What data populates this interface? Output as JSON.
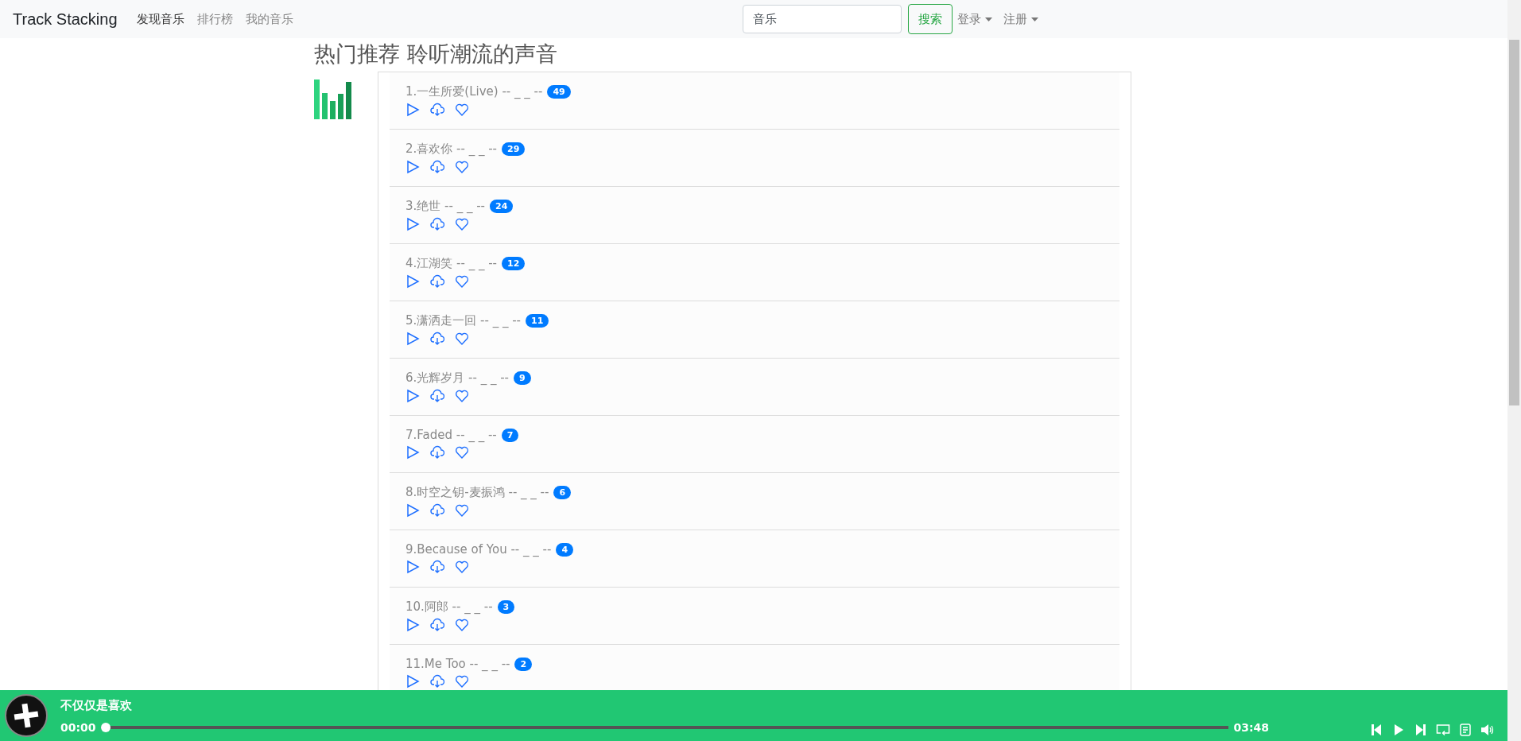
{
  "navbar": {
    "brand": "Track Stacking",
    "links": [
      {
        "label": "发现音乐",
        "selected": true
      },
      {
        "label": "排行榜",
        "selected": false
      },
      {
        "label": "我的音乐",
        "selected": false
      }
    ],
    "search": {
      "value": "音乐"
    },
    "search_button": "搜索",
    "menus": [
      "登录",
      "注册"
    ]
  },
  "heading": "热门推荐 聆听潮流的声音",
  "songs": [
    {
      "title": "1.一生所爱(Live) -- _ _ --",
      "count": "49"
    },
    {
      "title": "2.喜欢你 -- _ _ --",
      "count": "29"
    },
    {
      "title": "3.绝世 -- _ _ --",
      "count": "24"
    },
    {
      "title": "4.江湖笑 -- _ _ --",
      "count": "12"
    },
    {
      "title": "5.潇洒走一回 -- _ _ --",
      "count": "11"
    },
    {
      "title": "6.光辉岁月 -- _ _ --",
      "count": "9"
    },
    {
      "title": "7.Faded -- _ _ --",
      "count": "7"
    },
    {
      "title": "8.时空之钥-麦振鸿 -- _ _ --",
      "count": "6"
    },
    {
      "title": "9.Because of You -- _ _ --",
      "count": "4"
    },
    {
      "title": "10.阿郎 -- _ _ --",
      "count": "3"
    },
    {
      "title": "11.Me Too -- _ _ --",
      "count": "2"
    }
  ],
  "player": {
    "title": "不仅仅是喜欢",
    "current_time": "00:00",
    "duration": "03:48",
    "level": 0.0
  }
}
